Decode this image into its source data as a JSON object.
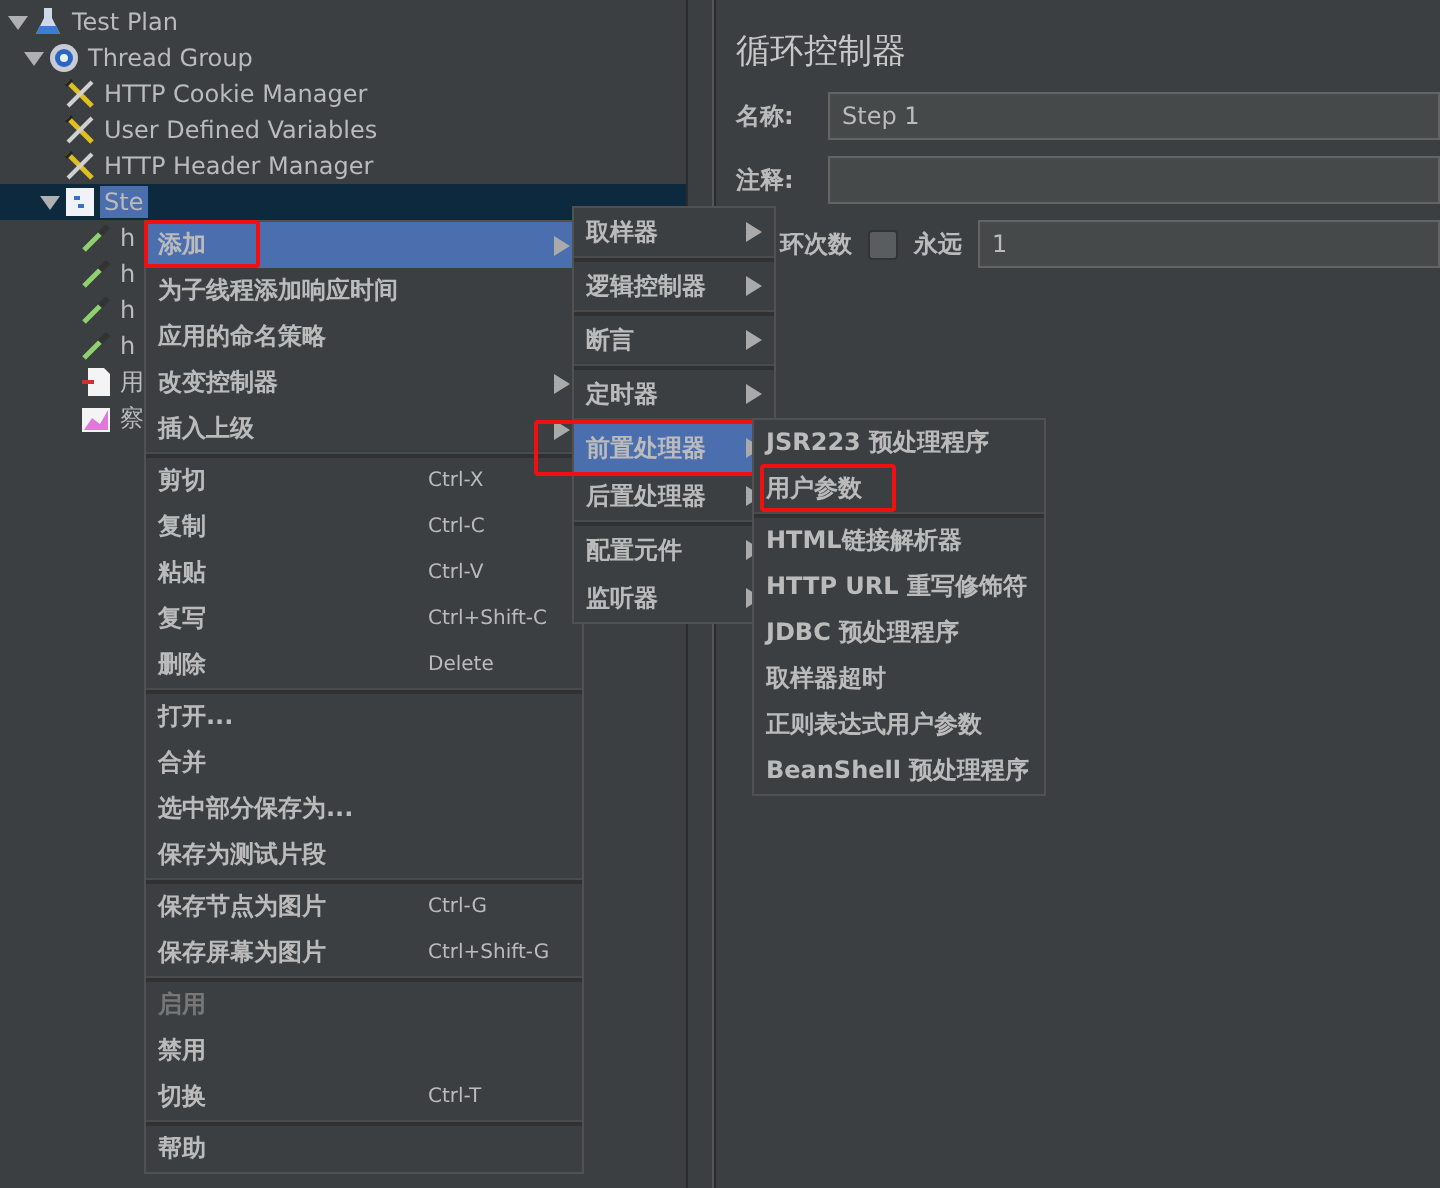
{
  "tree": [
    {
      "label": "Test Plan",
      "kind": "flask",
      "expanded": true,
      "selected": false,
      "children": [
        {
          "label": "Thread Group",
          "kind": "gear",
          "expanded": true,
          "selected": false,
          "children": [
            {
              "label": "HTTP Cookie Manager",
              "kind": "config",
              "selected": false
            },
            {
              "label": "User Defined Variables",
              "kind": "config",
              "selected": false
            },
            {
              "label": "HTTP Header Manager",
              "kind": "config",
              "selected": false
            },
            {
              "label": "Ste",
              "kind": "controller",
              "expanded": true,
              "selected": true,
              "children": [
                {
                  "label": "h",
                  "kind": "sampler",
                  "selected": false
                },
                {
                  "label": "h",
                  "kind": "sampler",
                  "selected": false
                },
                {
                  "label": "h",
                  "kind": "sampler",
                  "selected": false
                },
                {
                  "label": "h",
                  "kind": "sampler",
                  "selected": false
                },
                {
                  "label": "用",
                  "kind": "preprocessor",
                  "selected": false
                },
                {
                  "label": "察",
                  "kind": "listener",
                  "selected": false
                }
              ]
            }
          ]
        }
      ]
    }
  ],
  "panel": {
    "title": "循环控制器",
    "name_label": "名称:",
    "name_value": "Step 1",
    "comment_label": "注释:",
    "loops_label": "环次数",
    "forever_label": "永远",
    "forever_checked": false,
    "loops_value": "1"
  },
  "context_menu": {
    "groups": [
      [
        {
          "label": "添加",
          "submenu": true,
          "selected": true,
          "highlighted": true,
          "disabled": false
        },
        {
          "label": "为子线程添加响应时间",
          "submenu": false,
          "selected": false,
          "highlighted": false,
          "disabled": false
        },
        {
          "label": "应用的命名策略",
          "submenu": false,
          "selected": false,
          "highlighted": false,
          "disabled": false
        },
        {
          "label": "改变控制器",
          "submenu": true,
          "selected": false,
          "highlighted": false,
          "disabled": false
        },
        {
          "label": "插入上级",
          "submenu": true,
          "selected": false,
          "highlighted": false,
          "disabled": false
        }
      ],
      [
        {
          "label": "剪切",
          "shortcut": "Ctrl-X",
          "selected": false,
          "highlighted": false,
          "disabled": false
        },
        {
          "label": "复制",
          "shortcut": "Ctrl-C",
          "selected": false,
          "highlighted": false,
          "disabled": false
        },
        {
          "label": "粘贴",
          "shortcut": "Ctrl-V",
          "selected": false,
          "highlighted": false,
          "disabled": false
        },
        {
          "label": "复写",
          "shortcut": "Ctrl+Shift-C",
          "selected": false,
          "highlighted": false,
          "disabled": false
        },
        {
          "label": "删除",
          "shortcut": "Delete",
          "selected": false,
          "highlighted": false,
          "disabled": false
        }
      ],
      [
        {
          "label": "打开...",
          "selected": false,
          "highlighted": false,
          "disabled": false
        },
        {
          "label": "合并",
          "selected": false,
          "highlighted": false,
          "disabled": false
        },
        {
          "label": "选中部分保存为...",
          "selected": false,
          "highlighted": false,
          "disabled": false
        },
        {
          "label": "保存为测试片段",
          "selected": false,
          "highlighted": false,
          "disabled": false
        }
      ],
      [
        {
          "label": "保存节点为图片",
          "shortcut": "Ctrl-G",
          "selected": false,
          "highlighted": false,
          "disabled": false
        },
        {
          "label": "保存屏幕为图片",
          "shortcut": "Ctrl+Shift-G",
          "selected": false,
          "highlighted": false,
          "disabled": false
        }
      ],
      [
        {
          "label": "启用",
          "selected": false,
          "highlighted": false,
          "disabled": true
        },
        {
          "label": "禁用",
          "selected": false,
          "highlighted": false,
          "disabled": false
        },
        {
          "label": "切换",
          "shortcut": "Ctrl-T",
          "selected": false,
          "highlighted": false,
          "disabled": false
        }
      ],
      [
        {
          "label": "帮助",
          "selected": false,
          "highlighted": false,
          "disabled": false
        }
      ]
    ]
  },
  "add_submenu": {
    "groups": [
      [
        {
          "label": "取样器",
          "submenu": true,
          "selected": false,
          "highlighted": false
        }
      ],
      [
        {
          "label": "逻辑控制器",
          "submenu": true,
          "selected": false,
          "highlighted": false
        }
      ],
      [
        {
          "label": "断言",
          "submenu": true,
          "selected": false,
          "highlighted": false
        }
      ],
      [
        {
          "label": "定时器",
          "submenu": true,
          "selected": false,
          "highlighted": false
        }
      ],
      [
        {
          "label": "前置处理器",
          "submenu": true,
          "selected": true,
          "highlighted": true
        },
        {
          "label": "后置处理器",
          "submenu": true,
          "selected": false,
          "highlighted": false
        }
      ],
      [
        {
          "label": "配置元件",
          "submenu": true,
          "selected": false,
          "highlighted": false
        },
        {
          "label": "监听器",
          "submenu": true,
          "selected": false,
          "highlighted": false
        }
      ]
    ]
  },
  "preprocessor_submenu": {
    "groups": [
      [
        {
          "label": "JSR223 预处理程序",
          "selected": false,
          "highlighted": false
        },
        {
          "label": "用户参数",
          "selected": false,
          "highlighted": true
        }
      ],
      [
        {
          "label": "HTML链接解析器",
          "selected": false,
          "highlighted": false
        },
        {
          "label": "HTTP URL 重写修饰符",
          "selected": false,
          "highlighted": false
        },
        {
          "label": "JDBC 预处理程序",
          "selected": false,
          "highlighted": false
        },
        {
          "label": "取样器超时",
          "selected": false,
          "highlighted": false
        },
        {
          "label": "正则表达式用户参数",
          "selected": false,
          "highlighted": false
        },
        {
          "label": "BeanShell 预处理程序",
          "selected": false,
          "highlighted": false
        }
      ]
    ]
  }
}
